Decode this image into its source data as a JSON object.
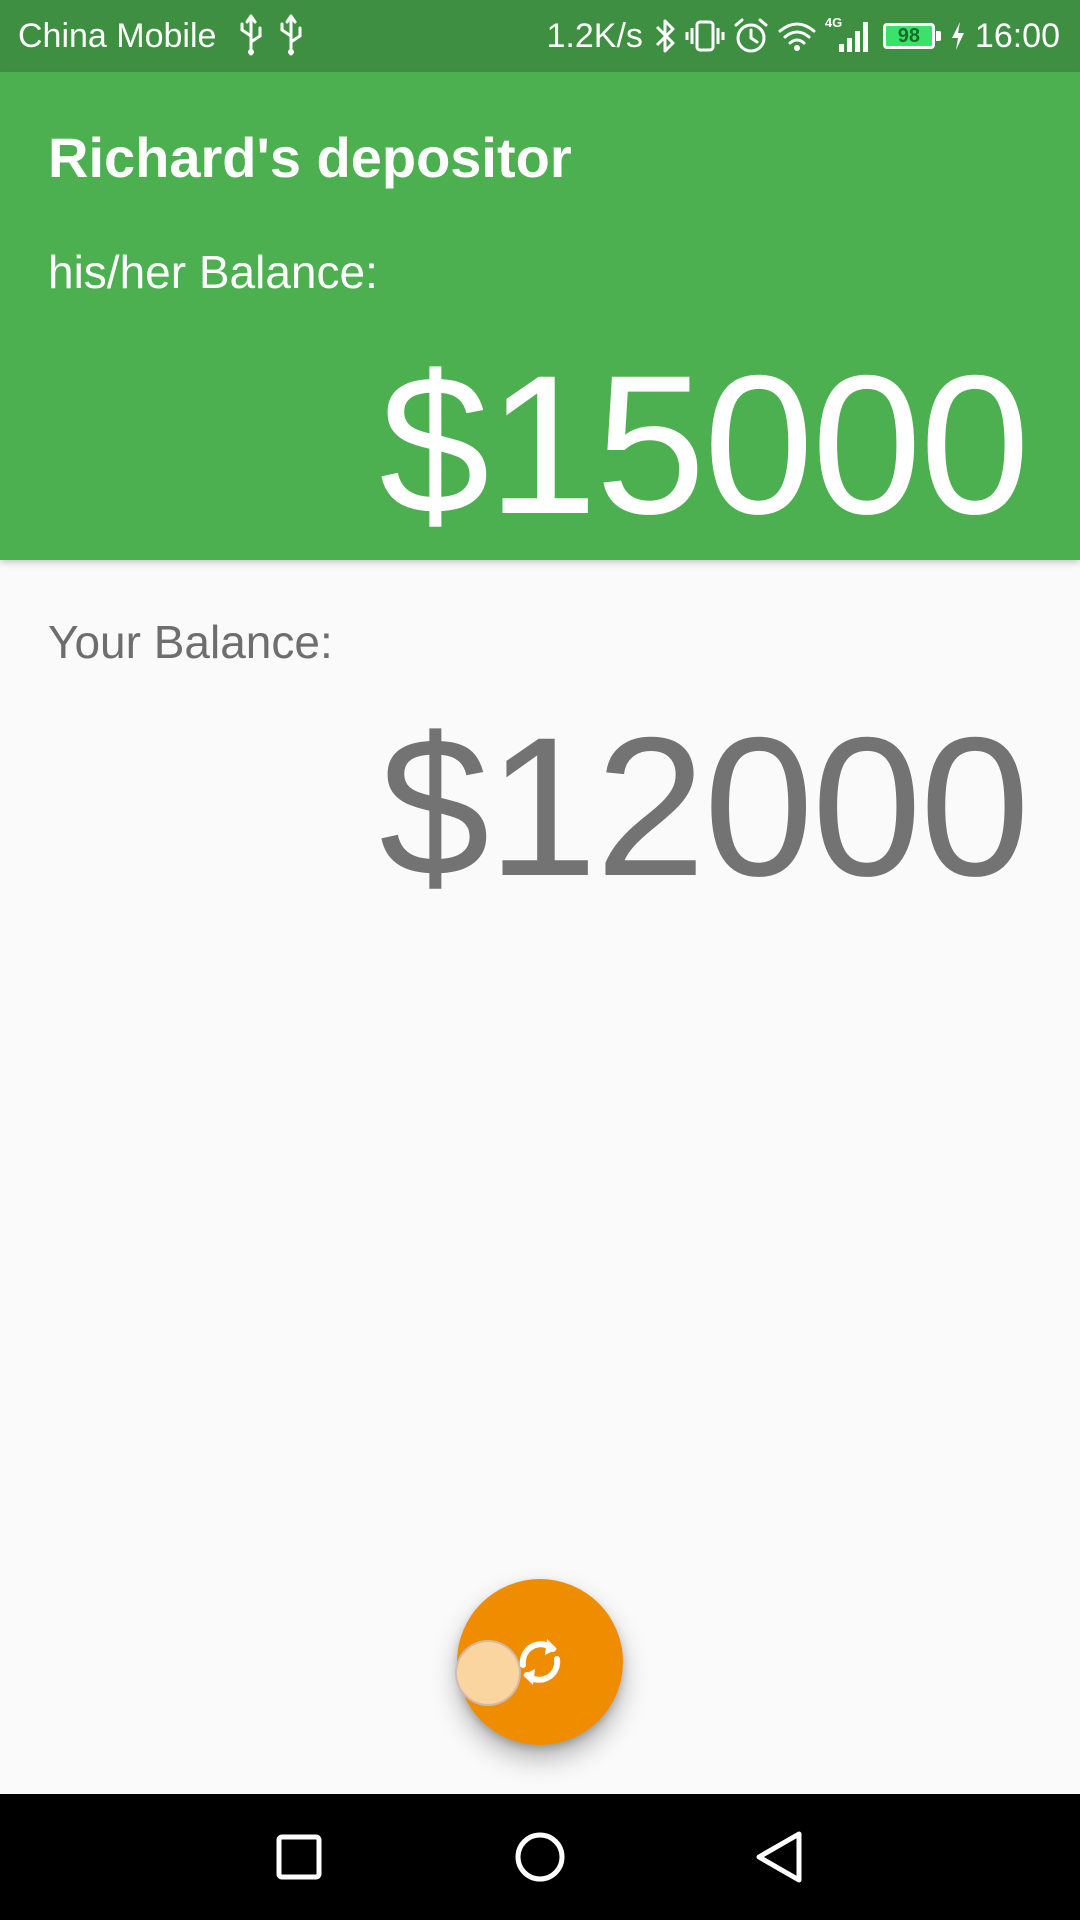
{
  "status_bar": {
    "carrier": "China Mobile",
    "network_speed": "1.2K/s",
    "network_type": "4G",
    "battery_level": "98",
    "time": "16:00",
    "icons": [
      "usb-icon",
      "usb-icon",
      "bluetooth-icon",
      "vibrate-icon",
      "alarm-icon",
      "wifi-icon",
      "signal-icon",
      "battery-icon",
      "charging-icon"
    ]
  },
  "header": {
    "title": "Richard's depositor",
    "balance_label": "his/her Balance:",
    "balance_value": "$15000",
    "background_color": "#4caf50"
  },
  "main": {
    "balance_label": "Your Balance:",
    "balance_value": "$12000",
    "text_color": "#737373"
  },
  "fab": {
    "icon": "sync-icon",
    "color": "#f08c00"
  },
  "nav_bar": {
    "buttons": [
      "recents-icon",
      "home-icon",
      "back-icon"
    ]
  }
}
